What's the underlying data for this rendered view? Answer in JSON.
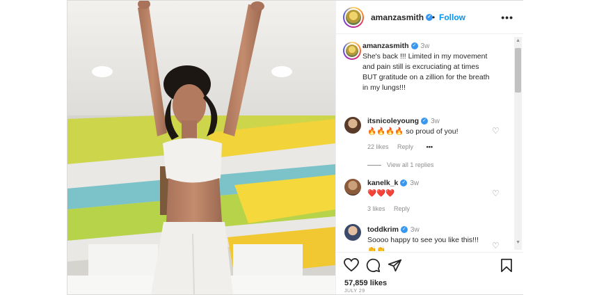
{
  "header": {
    "username": "amanzasmith",
    "separator": "•",
    "follow_label": "Follow",
    "more_label": "•••",
    "verified_mark": "✓"
  },
  "caption": {
    "username": "amanzasmith",
    "time": "3w",
    "text": "She's back !!! Limited in my movement and pain still is excruciating at times BUT gratitude on a zillion for the breath in my lungs!!!"
  },
  "comments": [
    {
      "username": "itsnicoleyoung",
      "time": "3w",
      "text": "🔥🔥🔥🔥 so proud of you!",
      "likes": "22 likes",
      "reply_label": "Reply",
      "more_label": "•••"
    },
    {
      "username": "kanelk_k",
      "time": "3w",
      "text": "❤️❤️❤️",
      "likes": "3 likes",
      "reply_label": "Reply"
    },
    {
      "username": "toddkrim",
      "time": "3w",
      "text": "Soooo happy to see you like this!!!",
      "extra": "👏👏"
    }
  ],
  "view_replies_label": "View all 1 replies",
  "footer": {
    "likes": "57,859 likes",
    "date": "JULY 29"
  },
  "icons": {
    "like": "heart-icon",
    "comment": "comment-icon",
    "share": "share-icon",
    "save": "bookmark-icon"
  },
  "colors": {
    "accent": "#0095f6",
    "verified": "#3897f0",
    "muted": "#8e8e8e"
  }
}
